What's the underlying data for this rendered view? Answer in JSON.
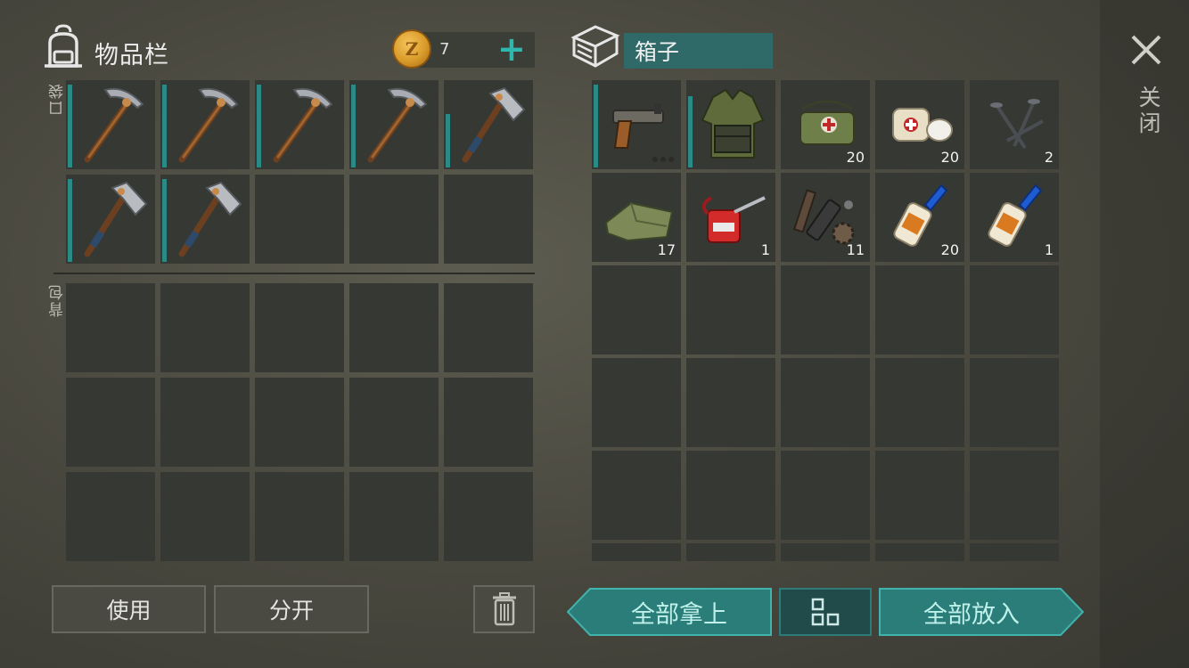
{
  "inventory": {
    "title": "物品栏",
    "coins": "7",
    "pocket_label": "口袋",
    "backpack_label": "背包",
    "pocket_slots": [
      {
        "item": "pickaxe",
        "icon": "pickaxe-icon"
      },
      {
        "item": "pickaxe",
        "icon": "pickaxe-icon"
      },
      {
        "item": "pickaxe",
        "icon": "pickaxe-icon"
      },
      {
        "item": "pickaxe",
        "icon": "pickaxe-icon"
      },
      {
        "item": "hatchet",
        "icon": "hatchet-icon"
      },
      {
        "item": "hatchet",
        "icon": "hatchet-icon"
      },
      {
        "item": "hatchet",
        "icon": "hatchet-icon"
      },
      {
        "item": "",
        "icon": ""
      },
      {
        "item": "",
        "icon": ""
      },
      {
        "item": "",
        "icon": ""
      }
    ],
    "use_button": "使用",
    "split_button": "分开"
  },
  "box": {
    "title": "箱子",
    "slots": [
      {
        "item": "flare-gun",
        "icon": "flare-gun-icon",
        "count": ""
      },
      {
        "item": "vest",
        "icon": "vest-icon",
        "count": ""
      },
      {
        "item": "first-aid-bag",
        "icon": "medkit-icon",
        "count": "20"
      },
      {
        "item": "bandage",
        "icon": "bandage-icon",
        "count": "20"
      },
      {
        "item": "nails",
        "icon": "nails-icon",
        "count": "2"
      },
      {
        "item": "cloth",
        "icon": "cloth-icon",
        "count": "17"
      },
      {
        "item": "oil-can",
        "icon": "oil-can-icon",
        "count": "1"
      },
      {
        "item": "spare-parts",
        "icon": "parts-icon",
        "count": "11"
      },
      {
        "item": "super-glue",
        "icon": "glue-icon",
        "count": "20"
      },
      {
        "item": "super-glue",
        "icon": "glue-icon",
        "count": "1"
      }
    ],
    "take_all_button": "全部拿上",
    "put_all_button": "全部放入"
  },
  "close_label": "关闭",
  "colors": {
    "accent": "#2b7d7a",
    "durability": "#2a8a85",
    "slot": "#363833"
  }
}
